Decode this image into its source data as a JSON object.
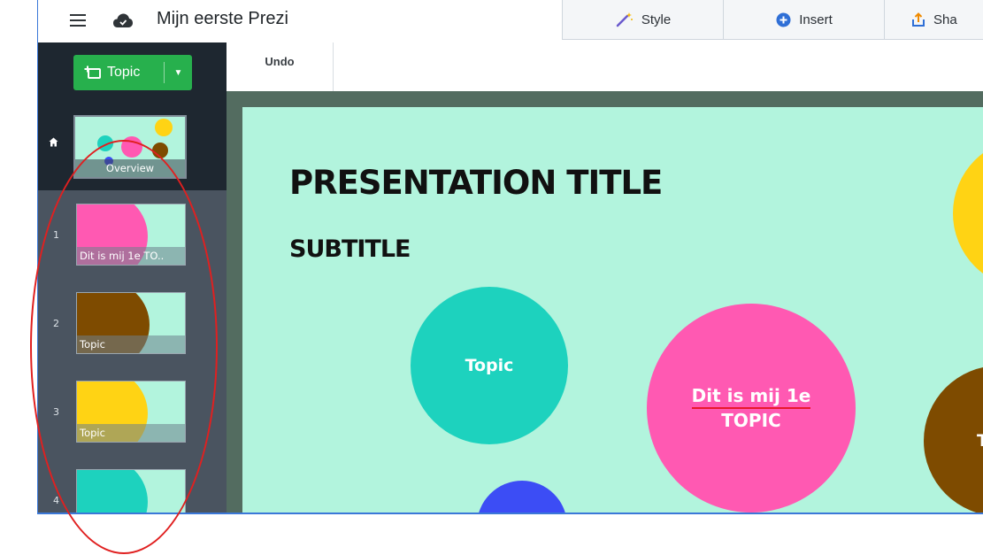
{
  "header": {
    "title": "Mijn eerste Prezi",
    "tabs": [
      {
        "label": "Style",
        "icon": "magic-wand-icon"
      },
      {
        "label": "Insert",
        "icon": "plus-circle-icon"
      },
      {
        "label": "Sha",
        "icon": "share-icon"
      }
    ]
  },
  "sidebar": {
    "add_button_label": "Topic",
    "overview": {
      "label": "Overview"
    },
    "items": [
      {
        "number": "1",
        "label": "Dit is mij 1e TO..",
        "color": "#ff59b2"
      },
      {
        "number": "2",
        "label": "Topic",
        "color": "#7e4b00"
      },
      {
        "number": "3",
        "label": "Topic",
        "color": "#ffd314"
      },
      {
        "number": "4",
        "label": "",
        "color": "#1dd2be"
      }
    ]
  },
  "toolbar": {
    "undo_label": "Undo"
  },
  "canvas": {
    "title": "PRESENTATION TITLE",
    "subtitle": "SUBTITLE",
    "topic_teal": "Topic",
    "topic_pink_line1": "Dit is mij 1e",
    "topic_pink_line2": "TOPIC",
    "topic_brown": "T"
  },
  "colors": {
    "canvas_bg": "#b2f4dd",
    "accent_green": "#27b04d",
    "sidebar_dark": "#1e2730",
    "annotation_red": "#e02020"
  }
}
